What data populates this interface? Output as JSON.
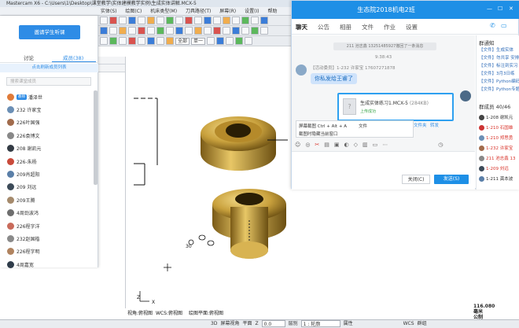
{
  "cad": {
    "title": "Mastercam X6 - C:\\Users\\1\\Desktop\\课堂教学\\实体建模教学实例\\生成实体讲解.MCX-5",
    "menu": [
      "实体(S)",
      "绘图(C)",
      "机床类型(M)",
      "刀具路径(T)",
      "屏幕(R)",
      "设置(I)",
      "帮助"
    ],
    "toolbar_selects": [
      "全部",
      "单一"
    ],
    "view_labels": [
      "视角:俯视图",
      "WCS:俯视图",
      "绘图平面:俯视图"
    ],
    "status": {
      "mode_3d": "3D",
      "screen_view": "屏幕视角",
      "plane": "平面",
      "z_label": "Z",
      "z_value": "0.0",
      "level_label": "层别",
      "level_value": "1 : 轮廓",
      "attr": "属性",
      "wcs": "WCS",
      "group": "群组"
    },
    "coord": {
      "x": "116.080",
      "unit": "毫米",
      "scale": "公制"
    },
    "axis_label": "Z",
    "axis_label_x": "X",
    "point_label": "30"
  },
  "course": {
    "invite_label": "邀请学生听课",
    "tabs": [
      {
        "label": "讨论"
      },
      {
        "label": "成员(38)"
      }
    ],
    "refresh_label": "点击刷新成员列表",
    "search_placeholder": "搜索课堂成员",
    "members": [
      {
        "name": "潘泽世",
        "badge": "教师",
        "color": "#e07b39"
      },
      {
        "name": "232 许家宝",
        "badge": "",
        "color": "#6b8fb5"
      },
      {
        "name": "226叶国强",
        "badge": "",
        "color": "#a16b4c"
      },
      {
        "name": "226袁博文",
        "badge": "",
        "color": "#888888"
      },
      {
        "name": "208 谢凯元",
        "badge": "",
        "color": "#333b44"
      },
      {
        "name": "226-朱杨",
        "badge": "",
        "color": "#c94a3a"
      },
      {
        "name": "209肖超阳",
        "badge": "",
        "color": "#5a7fa8"
      },
      {
        "name": "209 刘远",
        "badge": "",
        "color": "#3c4a58"
      },
      {
        "name": "209王腾",
        "badge": "",
        "color": "#a58a6c"
      },
      {
        "name": "4周劲波鸿",
        "badge": "",
        "color": "#6e6e6e"
      },
      {
        "name": "226程字洋",
        "badge": "",
        "color": "#c96b5b"
      },
      {
        "name": "232赵国楷",
        "badge": "",
        "color": "#8a8a8a"
      },
      {
        "name": "226程字明",
        "badge": "",
        "color": "#b0835f"
      },
      {
        "name": "4周嘉宽",
        "badge": "",
        "color": "#2f3c4a"
      }
    ]
  },
  "chat": {
    "title": "生态院2018机电2班",
    "nav": [
      "聊天",
      "公告",
      "相册",
      "文件",
      "作业",
      "设置"
    ],
    "recall_notice": "211 池志鑫 13251485927撤回了一条消息",
    "time": "9:38:43",
    "sender": "【活动委员】1-232 许家宝 17607271878",
    "message": "你私发给王睿了",
    "file": {
      "name": "生成实体练习1.MCX-5",
      "size": "(284KB)",
      "status": "上传成功"
    },
    "file_actions": [
      "打开",
      "打开文件夹",
      "转发"
    ],
    "screenshot_tip": {
      "line1": "屏幕截图 Ctrl + Alt + A",
      "line2": "截图时隐藏当前窗口",
      "file_word": "文件"
    },
    "close_label": "关闭(C)",
    "send_label": "发送(S)",
    "side": {
      "notice_title": "群通知",
      "notices": [
        "【文件】生成实体",
        "【文件】勿共享 安排",
        "【文件】标注到实习",
        "【文件】3月3日练",
        "【文件】Python编码",
        "【文件】Python专题"
      ],
      "members_title": "群成员 40/46",
      "members": [
        {
          "name": "1-208 谢凯元",
          "color": "#333333"
        },
        {
          "name": "1-210 石国雄",
          "color": "#d9342b"
        },
        {
          "name": "1-210 郑思勇",
          "color": "#d9342b"
        },
        {
          "name": "1-232 许家宝",
          "color": "#d9342b"
        },
        {
          "name": "211 池志鑫 13",
          "color": "#d9342b"
        },
        {
          "name": "1-209 刘远",
          "color": "#d9342b"
        },
        {
          "name": "1-211 龚本波",
          "color": "#333333"
        }
      ]
    }
  }
}
